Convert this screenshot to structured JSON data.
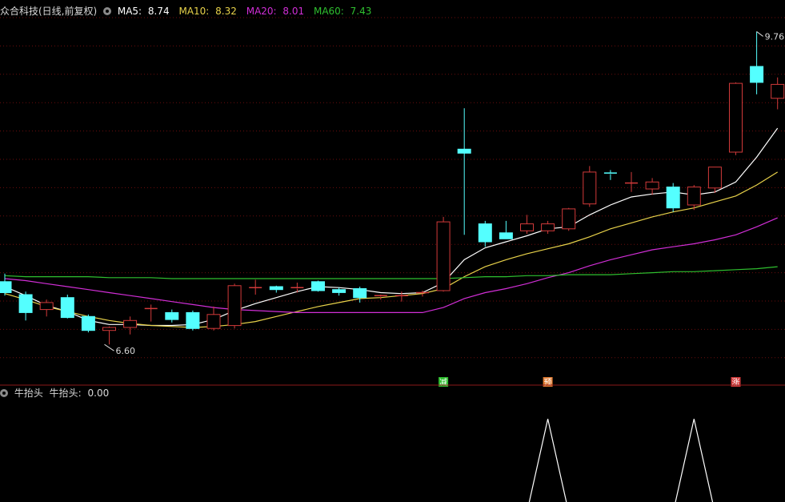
{
  "header": {
    "stock_title": "众合科技(日线,前复权)",
    "ma5_label": "MA5:",
    "ma5_value": "8.74",
    "ma10_label": "MA10:",
    "ma10_value": "8.32",
    "ma20_label": "MA20:",
    "ma20_value": "8.01",
    "ma60_label": "MA60:",
    "ma60_value": "7.43"
  },
  "indicator": {
    "name": "牛抬头",
    "value_label": "牛抬头:",
    "value": "0.00"
  },
  "colors": {
    "background": "#000000",
    "up": "#d23a3a",
    "down": "#54ffff",
    "ma5": "#ffffff",
    "ma10": "#e8d24a",
    "ma20": "#d12ed6",
    "ma60": "#2fbf2f",
    "grid": "#6b0d0d",
    "indicator_line": "#ffffff"
  },
  "chart_data": [
    {
      "type": "candlestick",
      "title": "众合科技(日线,前复权)",
      "y_range": [
        6.3,
        9.9
      ],
      "annotations": {
        "high_label": "9.76",
        "low_label": "6.60"
      },
      "signal_markers": [
        {
          "index": 21,
          "label": "减",
          "color": "#2fbf2f"
        },
        {
          "index": 26,
          "label": "预",
          "color": "#e07a30"
        },
        {
          "index": 35,
          "label": "涨",
          "color": "#d23a3a"
        }
      ],
      "candles": [
        {
          "o": 7.25,
          "h": 7.33,
          "l": 7.11,
          "c": 7.14
        },
        {
          "o": 7.12,
          "h": 7.15,
          "l": 6.86,
          "c": 6.94
        },
        {
          "o": 6.97,
          "h": 7.07,
          "l": 6.9,
          "c": 7.04
        },
        {
          "o": 7.09,
          "h": 7.12,
          "l": 6.88,
          "c": 6.89
        },
        {
          "o": 6.9,
          "h": 6.92,
          "l": 6.74,
          "c": 6.76
        },
        {
          "o": 6.76,
          "h": 6.8,
          "l": 6.62,
          "c": 6.79
        },
        {
          "o": 6.79,
          "h": 6.9,
          "l": 6.72,
          "c": 6.86
        },
        {
          "o": 6.98,
          "h": 7.02,
          "l": 6.85,
          "c": 6.98
        },
        {
          "o": 6.94,
          "h": 6.97,
          "l": 6.84,
          "c": 6.87
        },
        {
          "o": 6.94,
          "h": 6.96,
          "l": 6.76,
          "c": 6.78
        },
        {
          "o": 6.78,
          "h": 7.0,
          "l": 6.76,
          "c": 6.92
        },
        {
          "o": 6.81,
          "h": 7.23,
          "l": 6.78,
          "c": 7.21
        },
        {
          "o": 7.19,
          "h": 7.27,
          "l": 7.12,
          "c": 7.19
        },
        {
          "o": 7.2,
          "h": 7.21,
          "l": 7.14,
          "c": 7.17
        },
        {
          "o": 7.18,
          "h": 7.24,
          "l": 7.14,
          "c": 7.19
        },
        {
          "o": 7.25,
          "h": 7.26,
          "l": 7.15,
          "c": 7.16
        },
        {
          "o": 7.17,
          "h": 7.19,
          "l": 7.11,
          "c": 7.14
        },
        {
          "o": 7.18,
          "h": 7.2,
          "l": 7.04,
          "c": 7.09
        },
        {
          "o": 7.1,
          "h": 7.12,
          "l": 7.07,
          "c": 7.11
        },
        {
          "o": 7.11,
          "h": 7.15,
          "l": 7.05,
          "c": 7.11
        },
        {
          "o": 7.13,
          "h": 7.16,
          "l": 7.1,
          "c": 7.14
        },
        {
          "o": 7.16,
          "h": 7.9,
          "l": 7.15,
          "c": 7.85
        },
        {
          "o": 8.58,
          "h": 8.99,
          "l": 7.72,
          "c": 8.54
        },
        {
          "o": 7.83,
          "h": 7.86,
          "l": 7.6,
          "c": 7.65
        },
        {
          "o": 7.74,
          "h": 7.86,
          "l": 7.68,
          "c": 7.68
        },
        {
          "o": 7.76,
          "h": 7.92,
          "l": 7.73,
          "c": 7.83
        },
        {
          "o": 7.76,
          "h": 7.86,
          "l": 7.73,
          "c": 7.83
        },
        {
          "o": 7.78,
          "h": 7.99,
          "l": 7.76,
          "c": 7.98
        },
        {
          "o": 8.03,
          "h": 8.41,
          "l": 8.0,
          "c": 8.35
        },
        {
          "o": 8.34,
          "h": 8.37,
          "l": 8.27,
          "c": 8.33
        },
        {
          "o": 8.24,
          "h": 8.35,
          "l": 8.15,
          "c": 8.24
        },
        {
          "o": 8.18,
          "h": 8.29,
          "l": 8.12,
          "c": 8.25
        },
        {
          "o": 8.2,
          "h": 8.24,
          "l": 7.95,
          "c": 7.99
        },
        {
          "o": 8.02,
          "h": 8.22,
          "l": 7.97,
          "c": 8.2
        },
        {
          "o": 8.19,
          "h": 8.4,
          "l": 8.14,
          "c": 8.4
        },
        {
          "o": 8.55,
          "h": 9.25,
          "l": 8.52,
          "c": 9.24
        },
        {
          "o": 9.41,
          "h": 9.76,
          "l": 9.13,
          "c": 9.25
        },
        {
          "o": 9.09,
          "h": 9.3,
          "l": 8.98,
          "c": 9.23
        }
      ],
      "series": [
        {
          "name": "MA5",
          "color": "#ffffff",
          "values": [
            7.2,
            7.11,
            7.01,
            6.95,
            6.86,
            6.82,
            6.82,
            6.81,
            6.81,
            6.82,
            6.87,
            6.96,
            7.03,
            7.09,
            7.15,
            7.2,
            7.19,
            7.17,
            7.14,
            7.13,
            7.14,
            7.24,
            7.47,
            7.59,
            7.65,
            7.71,
            7.78,
            7.8,
            7.92,
            8.02,
            8.1,
            8.13,
            8.15,
            8.12,
            8.15,
            8.25,
            8.5,
            8.79
          ]
        },
        {
          "name": "MA10",
          "color": "#e8d24a",
          "values": [
            7.13,
            7.07,
            7.0,
            6.95,
            6.9,
            6.86,
            6.83,
            6.81,
            6.8,
            6.79,
            6.8,
            6.82,
            6.85,
            6.9,
            6.95,
            7.0,
            7.04,
            7.08,
            7.09,
            7.11,
            7.13,
            7.18,
            7.3,
            7.4,
            7.47,
            7.53,
            7.58,
            7.63,
            7.7,
            7.78,
            7.84,
            7.9,
            7.95,
            7.99,
            8.05,
            8.11,
            8.22,
            8.35
          ]
        },
        {
          "name": "MA20",
          "color": "#d12ed6",
          "values": [
            7.28,
            7.26,
            7.23,
            7.2,
            7.17,
            7.14,
            7.11,
            7.08,
            7.05,
            7.02,
            6.99,
            6.97,
            6.96,
            6.95,
            6.94,
            6.94,
            6.94,
            6.94,
            6.94,
            6.94,
            6.94,
            6.99,
            7.08,
            7.14,
            7.18,
            7.23,
            7.29,
            7.34,
            7.41,
            7.47,
            7.52,
            7.57,
            7.6,
            7.63,
            7.67,
            7.72,
            7.8,
            7.89
          ]
        },
        {
          "name": "MA60",
          "color": "#2fbf2f",
          "values": [
            7.31,
            7.3,
            7.3,
            7.3,
            7.3,
            7.29,
            7.29,
            7.29,
            7.28,
            7.28,
            7.28,
            7.28,
            7.28,
            7.28,
            7.28,
            7.28,
            7.28,
            7.28,
            7.28,
            7.28,
            7.28,
            7.28,
            7.29,
            7.3,
            7.3,
            7.31,
            7.31,
            7.32,
            7.32,
            7.32,
            7.33,
            7.34,
            7.35,
            7.35,
            7.36,
            7.37,
            7.38,
            7.4
          ]
        }
      ]
    },
    {
      "type": "line",
      "title": "牛抬头",
      "y_range": [
        0,
        1.2
      ],
      "series": [
        {
          "name": "牛抬头",
          "color": "#ffffff",
          "values": [
            0,
            0,
            0,
            0,
            0,
            0,
            0,
            0,
            0,
            0,
            0,
            0,
            0,
            0,
            0,
            0,
            0,
            0,
            0,
            0,
            0,
            0,
            0,
            0,
            0,
            0,
            1,
            0,
            0,
            0,
            0,
            0,
            0,
            1,
            0,
            0,
            0,
            0
          ]
        }
      ]
    }
  ]
}
